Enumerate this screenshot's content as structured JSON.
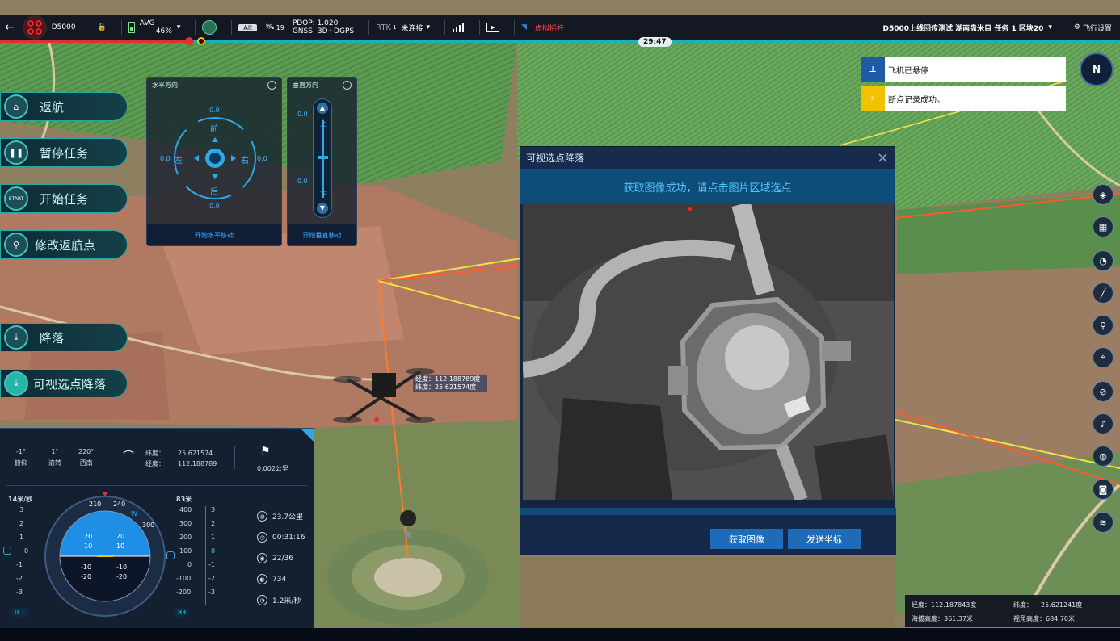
{
  "topbar": {
    "back_icon": "arrow-left-icon",
    "drone_model": "D5000",
    "battery_label": "AVG",
    "battery_percent": "46%",
    "mode_badge": "Alt",
    "satellites": "19",
    "pdop": "PDOP: 1.020",
    "gnss": "GNSS: 3D+DGPS",
    "rtk_label": "RTK",
    "rtk_sub": "1",
    "rtk_status": "未连接",
    "virtual_stick": "虚拟摇杆",
    "mission_info": "D5000上线回传测试 湖南盘米目 任务 1 区块20",
    "flight_settings": "飞行设置",
    "timer": "29:47",
    "accent": "#1ed0d0"
  },
  "actions": [
    {
      "label": "返航",
      "icon": "return-home-icon"
    },
    {
      "label": "暂停任务",
      "icon": "pause-icon"
    },
    {
      "label": "开始任务",
      "icon": "start-icon",
      "icon_text": "START"
    },
    {
      "label": "修改返航点",
      "icon": "edit-home-point-icon"
    },
    {
      "label": "降落",
      "icon": "land-icon"
    },
    {
      "label": "可视选点降落",
      "icon": "visual-landing-icon"
    }
  ],
  "horizontal_panel": {
    "title": "水平方向",
    "front": "前",
    "back": "后",
    "left": "左",
    "right": "右",
    "top_value": "0.0",
    "bottom_value": "0.0",
    "left_value": "0.0",
    "right_value": "0.0",
    "button": "开始水平移动"
  },
  "vertical_panel": {
    "title": "垂直方向",
    "up": "上",
    "down": "下",
    "top_value": "0.0",
    "bottom_value": "0.0",
    "button": "开始垂直移动"
  },
  "notices": [
    {
      "text": "飞机已悬停",
      "icon": "hover-icon",
      "color": "#1f5aa6"
    },
    {
      "text": "断点记录成功。",
      "icon": "breakpoint-icon",
      "color": "#f2c200"
    }
  ],
  "modal": {
    "title": "可视选点降落",
    "subtitle": "获取图像成功，请点击图片区域选点",
    "btn_get_image": "获取图像",
    "btn_send_coords": "发送坐标"
  },
  "drone_tag": {
    "lon_label": "经度：",
    "lon": "112.188789度",
    "lat_label": "纬度：",
    "lat": "25.621574度"
  },
  "telemetry": {
    "pitch": "-1°",
    "pitch_label": "俯仰",
    "roll": "1°",
    "roll_label": "滚转",
    "heading": "220°",
    "heading_label": "西南",
    "lat_label": "纬度：",
    "lat": "25.621574",
    "lon_label": "经度：",
    "lon": "112.188789",
    "distance": "0.002公里",
    "speed_title": "14米/秒",
    "speed_value": "0.1",
    "alt_title": "83米",
    "alt_value": "83",
    "speed_ticks": [
      "3",
      "2",
      "1",
      "0",
      "-1",
      "-2",
      "-3"
    ],
    "alt_ticks": [
      "400",
      "300",
      "200",
      "100",
      "0",
      "-100",
      "-200"
    ],
    "vs_ticks": [
      "3",
      "2",
      "1",
      "0",
      "-1",
      "-2",
      "-3"
    ],
    "attitude": {
      "top": [
        "20",
        "20"
      ],
      "mid": [
        "10",
        "10"
      ],
      "bot1": [
        "-10",
        "-10"
      ],
      "bot2": [
        "-20",
        "-20"
      ]
    },
    "compass_labels": [
      "210",
      "240",
      "W",
      "300"
    ],
    "right_stats": [
      {
        "icon": "globe-icon",
        "value": "23.7公里"
      },
      {
        "icon": "clock-icon",
        "value": "00:31:16"
      },
      {
        "icon": "target-icon",
        "value": "22/36"
      },
      {
        "icon": "battery-cycle-icon",
        "value": "734"
      },
      {
        "icon": "speed-icon",
        "value": "1.2米/秒"
      }
    ]
  },
  "coords_box": {
    "lon_label": "经度：",
    "lon": "112.187843度",
    "lat_label": "纬度：",
    "lat": "25.621241度",
    "alt_label": "海拔高度：",
    "alt": "361.37米",
    "view_label": "视角高度：",
    "view": "684.70米"
  },
  "right_tools": [
    "layers-icon",
    "map-icon",
    "gauge-icon",
    "ruler-icon",
    "location-icon",
    "crosshair-icon",
    "no-fly-icon",
    "speaker-icon",
    "globe-icon",
    "camera-icon",
    "stack-icon"
  ],
  "compass": {
    "letter": "N"
  }
}
